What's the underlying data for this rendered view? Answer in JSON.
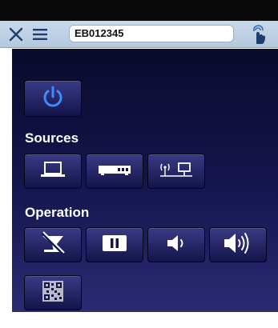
{
  "toolbar": {
    "url_value": "EB012345",
    "icons": {
      "close": "close-icon",
      "menu": "hamburger-menu-icon",
      "touch": "touch-hand-icon"
    }
  },
  "sections": {
    "sources_label": "Sources",
    "operation_label": "Operation"
  },
  "icons": {
    "power": "power-icon",
    "computer": "laptop-icon",
    "video": "video-player-icon",
    "network": "network-computer-icon",
    "av_mute": "av-mute-icon",
    "freeze": "pause-icon",
    "volume_down": "volume-down-icon",
    "volume_up": "volume-up-icon",
    "qr": "qr-code-icon"
  },
  "colors": {
    "panel_top": "#0a0a2c",
    "panel_bottom": "#2b2b72",
    "button_face": "#2a2a6c",
    "power_icon": "#3d8bff",
    "toolbar": "#c9d9ea"
  }
}
